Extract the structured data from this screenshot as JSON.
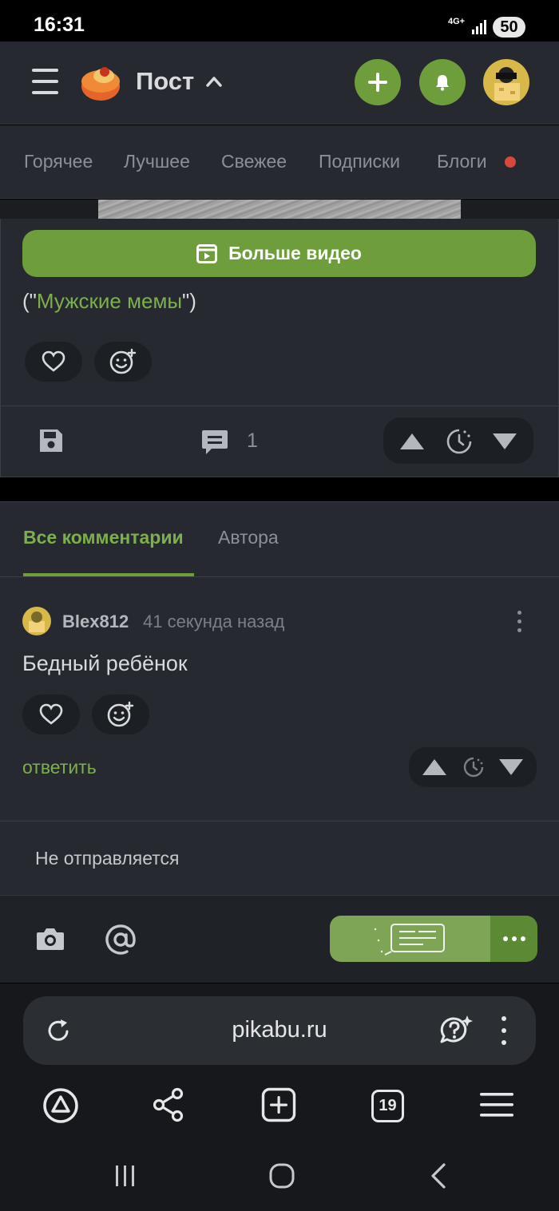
{
  "status_bar": {
    "time": "16:31",
    "network": "4G+",
    "battery": "50"
  },
  "header": {
    "title": "Пост"
  },
  "feed_tabs": [
    "Горячее",
    "Лучшее",
    "Свежее",
    "Подписки",
    "Блоги"
  ],
  "post": {
    "more_video_label": "Больше видео",
    "source_prefix": "(\"",
    "source_link": "Мужские мемы",
    "source_suffix": "\")",
    "comments_count": "1"
  },
  "comments": {
    "tabs": [
      "Все комментарии",
      "Автора"
    ],
    "items": [
      {
        "author": "Blex812",
        "time": "41 секунда назад",
        "text": "Бедный ребёнок",
        "reply_label": "ответить"
      }
    ]
  },
  "composer": {
    "input_value": "Не отправляется"
  },
  "browser": {
    "url": "pikabu.ru",
    "tab_count": "19"
  },
  "colors": {
    "accent_green": "#6e9e3c",
    "link_green": "#7cb04a",
    "background": "#262a30",
    "notification_dot": "#d9463a"
  }
}
